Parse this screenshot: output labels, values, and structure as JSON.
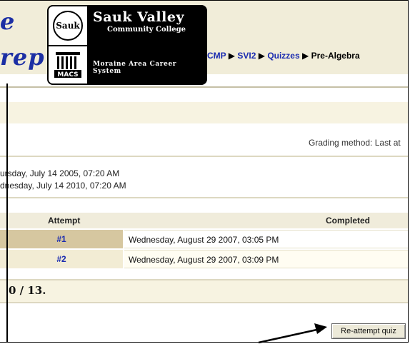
{
  "header": {
    "logo_script_top": "e",
    "logo_script_bottom": "rep",
    "sauk_badge": "Sauk",
    "sauk_title": "Sauk Valley",
    "sauk_subtitle": "Community College",
    "macs_badge": "MACS",
    "macs_name": "Moraine Area Career System"
  },
  "breadcrumb": {
    "items": [
      {
        "label": "CMP",
        "link": true
      },
      {
        "label": "SVI2",
        "link": true
      },
      {
        "label": "Quizzes",
        "link": true
      },
      {
        "label": "Pre-Algebra",
        "link": false
      }
    ],
    "separator": "▶"
  },
  "quiz_info": {
    "grading_method": "Grading method: Last at",
    "opened": "ursday, July 14 2005, 07:20 AM",
    "closes": "dnesday, July 14 2010, 07:20 AM"
  },
  "attempts_table": {
    "headers": {
      "attempt": "Attempt",
      "completed": "Completed"
    },
    "rows": [
      {
        "attempt": "#1",
        "completed": "Wednesday, August 29 2007, 03:05 PM"
      },
      {
        "attempt": "#2",
        "completed": "Wednesday, August 29 2007, 03:09 PM"
      }
    ]
  },
  "score": {
    "text": "0 / 13."
  },
  "actions": {
    "reattempt_label": "Re-attempt quiz"
  },
  "icons": {
    "sauk": "sauk-emblem-icon",
    "macs": "macs-building-icon",
    "breadcrumb_sep": "triangle-right-icon"
  }
}
